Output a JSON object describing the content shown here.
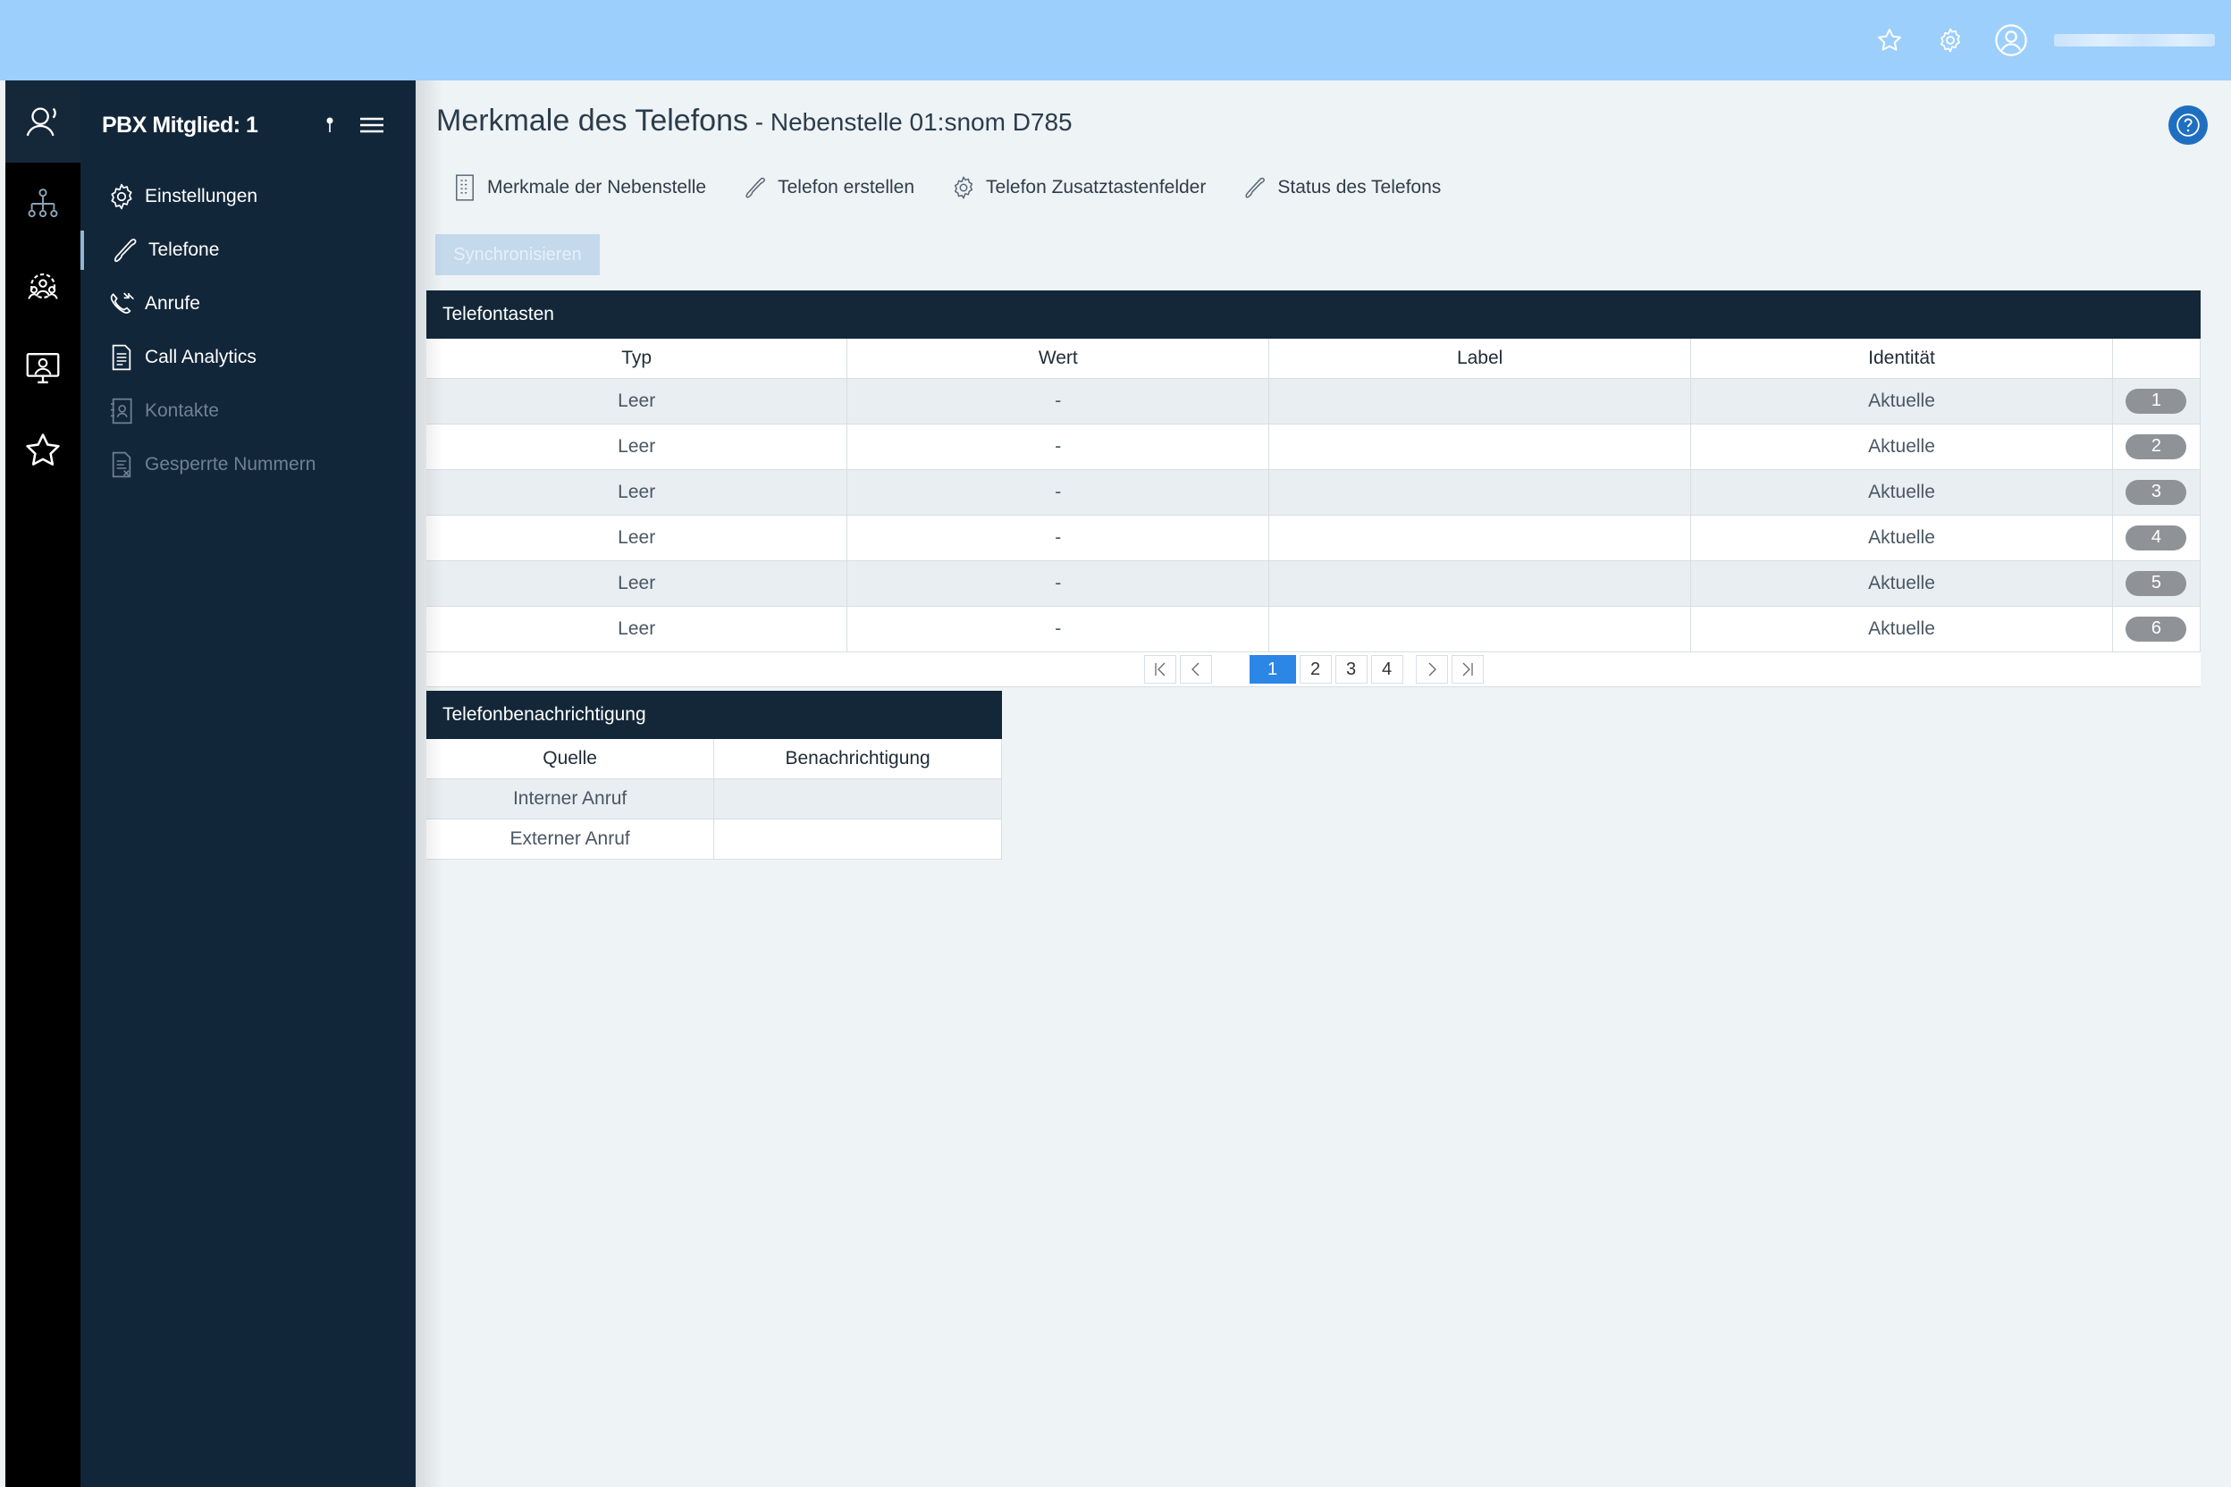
{
  "topbar": {
    "icons": [
      "star-icon",
      "gear-icon",
      "user-icon"
    ],
    "user_name_redacted": ""
  },
  "rail": {
    "items": [
      "headset-user-icon",
      "org-chart-icon",
      "users-gear-icon",
      "monitor-user-icon",
      "star-icon"
    ]
  },
  "sidebar": {
    "title": "PBX Mitglied: 1",
    "items": [
      {
        "label": "Einstellungen",
        "icon": "gear-icon"
      },
      {
        "label": "Telefone",
        "icon": "phone-icon"
      },
      {
        "label": "Anrufe",
        "icon": "phone-calls-icon"
      },
      {
        "label": "Call Analytics",
        "icon": "document-icon"
      },
      {
        "label": "Kontakte",
        "icon": "contacts-icon"
      },
      {
        "label": "Gesperrte Nummern",
        "icon": "blocked-doc-icon"
      }
    ]
  },
  "page": {
    "title": "Merkmale des Telefons",
    "subtitle": " - Nebenstelle 01:snom D785"
  },
  "tabs": [
    {
      "label": "Merkmale der Nebenstelle",
      "icon": "phone-keypad-icon"
    },
    {
      "label": "Telefon erstellen",
      "icon": "phone-icon"
    },
    {
      "label": "Telefon Zusatztastenfelder",
      "icon": "gear-icon"
    },
    {
      "label": "Status des Telefons",
      "icon": "phone-icon"
    }
  ],
  "sync_button": "Synchronisieren",
  "telefontasten": {
    "title": "Telefontasten",
    "columns": [
      "Typ",
      "Wert",
      "Label",
      "Identität",
      ""
    ],
    "rows": [
      {
        "typ": "Leer",
        "wert": "-",
        "label": "",
        "identitaet": "Aktuelle",
        "nr": "1"
      },
      {
        "typ": "Leer",
        "wert": "-",
        "label": "",
        "identitaet": "Aktuelle",
        "nr": "2"
      },
      {
        "typ": "Leer",
        "wert": "-",
        "label": "",
        "identitaet": "Aktuelle",
        "nr": "3"
      },
      {
        "typ": "Leer",
        "wert": "-",
        "label": "",
        "identitaet": "Aktuelle",
        "nr": "4"
      },
      {
        "typ": "Leer",
        "wert": "-",
        "label": "",
        "identitaet": "Aktuelle",
        "nr": "5"
      },
      {
        "typ": "Leer",
        "wert": "-",
        "label": "",
        "identitaet": "Aktuelle",
        "nr": "6"
      }
    ],
    "pages": [
      "1",
      "2",
      "3",
      "4"
    ],
    "current_page": "1"
  },
  "benachrichtigung": {
    "title": "Telefonbenachrichtigung",
    "columns": [
      "Quelle",
      "Benachrichtigung"
    ],
    "rows": [
      {
        "quelle": "Interner Anruf",
        "benachrichtigung": ""
      },
      {
        "quelle": "Externer Anruf",
        "benachrichtigung": ""
      }
    ]
  }
}
